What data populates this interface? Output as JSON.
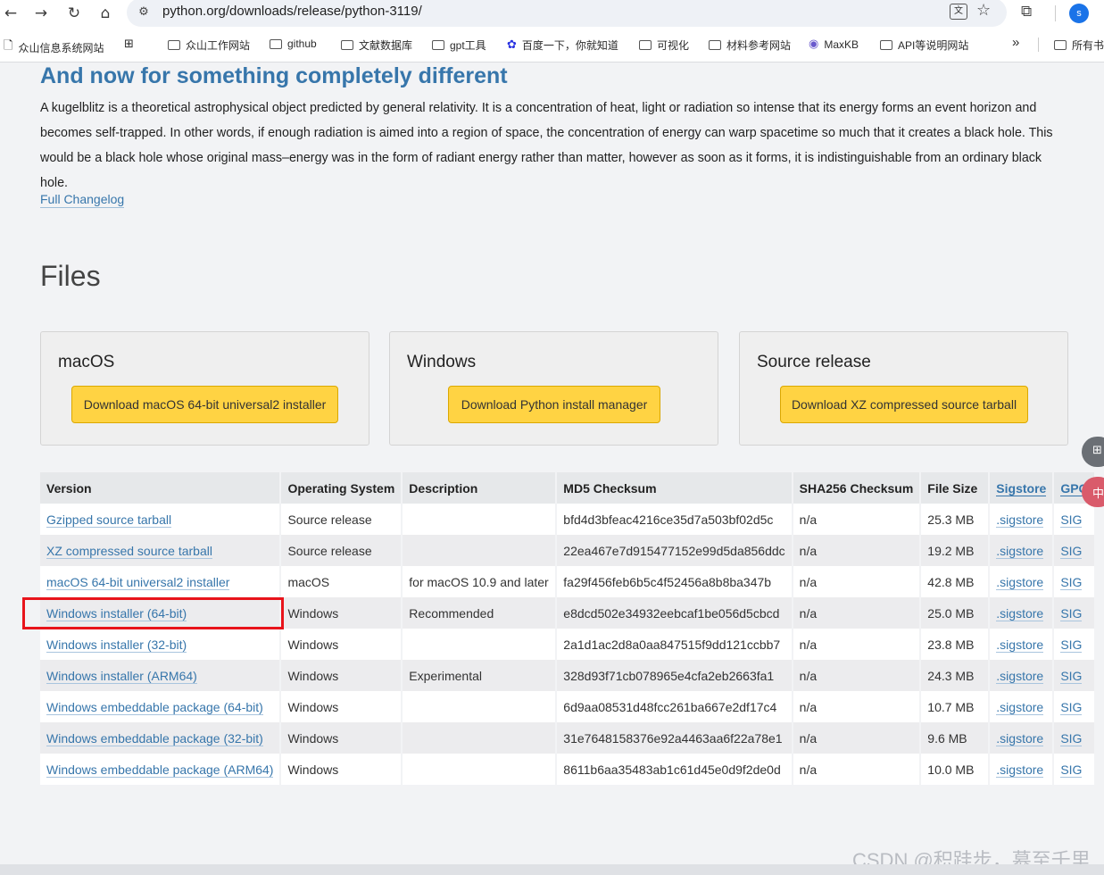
{
  "browser": {
    "url": "python.org/downloads/release/python-3119/",
    "avatar_letter": "s",
    "bookmarks": [
      "众山信息系统网站",
      "众山工作网站",
      "github",
      "文献数据库",
      "gpt工具",
      "百度一下，你就知道",
      "可视化",
      "材料参考网站",
      "MaxKB",
      "API等说明网站",
      "所有书"
    ],
    "more": "»"
  },
  "content": {
    "heading": "And now for something completely different",
    "paragraph": "A kugelblitz is a theoretical astrophysical object predicted by general relativity. It is a concentration of heat, light or radiation so intense that its energy forms an event horizon and becomes self-trapped. In other words, if enough radiation is aimed into a region of space, the concentration of energy can warp spacetime so much that it creates a black hole. This would be a black hole whose original mass–energy was in the form of radiant energy rather than matter, however as soon as it forms, it is indistinguishable from an ordinary black hole.",
    "changelog": "Full Changelog",
    "files_heading": "Files"
  },
  "cards": [
    {
      "title": "macOS",
      "button": "Download macOS 64-bit universal2 installer"
    },
    {
      "title": "Windows",
      "button": "Download Python install manager"
    },
    {
      "title": "Source release",
      "button": "Download XZ compressed source tarball"
    }
  ],
  "table": {
    "headers": [
      "Version",
      "Operating System",
      "Description",
      "MD5 Checksum",
      "SHA256 Checksum",
      "File Size",
      "Sigstore",
      "GPG"
    ],
    "rows": [
      [
        "Gzipped source tarball",
        "Source release",
        "",
        "bfd4d3bfeac4216ce35d7a503bf02d5c",
        "n/a",
        "25.3 MB",
        ".sigstore",
        "SIG"
      ],
      [
        "XZ compressed source tarball",
        "Source release",
        "",
        "22ea467e7d915477152e99d5da856ddc",
        "n/a",
        "19.2 MB",
        ".sigstore",
        "SIG"
      ],
      [
        "macOS 64-bit universal2 installer",
        "macOS",
        "for macOS 10.9 and later",
        "fa29f456feb6b5c4f52456a8b8ba347b",
        "n/a",
        "42.8 MB",
        ".sigstore",
        "SIG"
      ],
      [
        "Windows installer (64-bit)",
        "Windows",
        "Recommended",
        "e8dcd502e34932eebcaf1be056d5cbcd",
        "n/a",
        "25.0 MB",
        ".sigstore",
        "SIG"
      ],
      [
        "Windows installer (32-bit)",
        "Windows",
        "",
        "2a1d1ac2d8a0aa847515f9dd121ccbb7",
        "n/a",
        "23.8 MB",
        ".sigstore",
        "SIG"
      ],
      [
        "Windows installer (ARM64)",
        "Windows",
        "Experimental",
        "328d93f71cb078965e4cfa2eb2663fa1",
        "n/a",
        "24.3 MB",
        ".sigstore",
        "SIG"
      ],
      [
        "Windows embeddable package (64-bit)",
        "Windows",
        "",
        "6d9aa08531d48fcc261ba667e2df17c4",
        "n/a",
        "10.7 MB",
        ".sigstore",
        "SIG"
      ],
      [
        "Windows embeddable package (32-bit)",
        "Windows",
        "",
        "31e7648158376e92a4463aa6f22a78e1",
        "n/a",
        "9.6 MB",
        ".sigstore",
        "SIG"
      ],
      [
        "Windows embeddable package (ARM64)",
        "Windows",
        "",
        "8611b6aa35483ab1c61d45e0d9f2de0d",
        "n/a",
        "10.0 MB",
        ".sigstore",
        "SIG"
      ]
    ]
  },
  "highlight_color": "#e8141b",
  "accent_color": "#3776ab",
  "button_color": "#ffd343",
  "watermark": "CSDN @积跬步，慕至千里",
  "side_tools": {
    "grid_glyph": "⊞",
    "translate_glyph": "中"
  },
  "icons": [
    "back-icon",
    "forward-icon",
    "reload-icon",
    "home-icon",
    "site-info-icon",
    "translate-icon",
    "star-icon",
    "extensions-icon",
    "folder-icon",
    "apps-grid-icon"
  ]
}
